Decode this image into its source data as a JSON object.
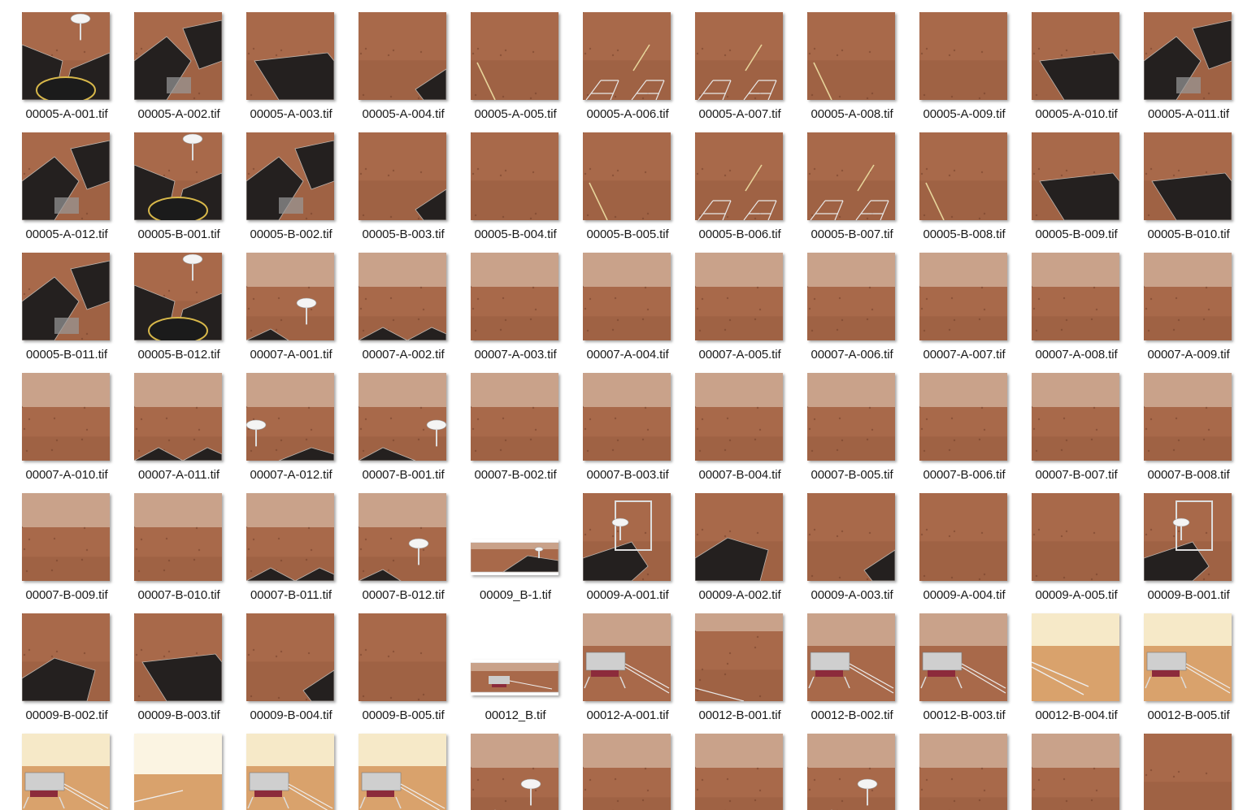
{
  "files": [
    {
      "name": "00005-A-001.tif",
      "kind": "rover_dish"
    },
    {
      "name": "00005-A-002.tif",
      "kind": "rover_panel"
    },
    {
      "name": "00005-A-003.tif",
      "kind": "panel_ground"
    },
    {
      "name": "00005-A-004.tif",
      "kind": "ground_panel_corner"
    },
    {
      "name": "00005-A-005.tif",
      "kind": "ground_rod"
    },
    {
      "name": "00005-A-006.tif",
      "kind": "ground_ramp"
    },
    {
      "name": "00005-A-007.tif",
      "kind": "ground_ramp"
    },
    {
      "name": "00005-A-008.tif",
      "kind": "ground_rod"
    },
    {
      "name": "00005-A-009.tif",
      "kind": "ground"
    },
    {
      "name": "00005-A-010.tif",
      "kind": "panel_ground"
    },
    {
      "name": "00005-A-011.tif",
      "kind": "rover_panel"
    },
    {
      "name": "00005-A-012.tif",
      "kind": "rover_panel"
    },
    {
      "name": "00005-B-001.tif",
      "kind": "rover_dish"
    },
    {
      "name": "00005-B-002.tif",
      "kind": "rover_panel"
    },
    {
      "name": "00005-B-003.tif",
      "kind": "ground_panel_corner"
    },
    {
      "name": "00005-B-004.tif",
      "kind": "ground"
    },
    {
      "name": "00005-B-005.tif",
      "kind": "ground_rod"
    },
    {
      "name": "00005-B-006.tif",
      "kind": "ground_ramp"
    },
    {
      "name": "00005-B-007.tif",
      "kind": "ground_ramp"
    },
    {
      "name": "00005-B-008.tif",
      "kind": "ground_rod"
    },
    {
      "name": "00005-B-009.tif",
      "kind": "panel_ground"
    },
    {
      "name": "00005-B-010.tif",
      "kind": "panel_ground"
    },
    {
      "name": "00005-B-011.tif",
      "kind": "rover_panel"
    },
    {
      "name": "00005-B-012.tif",
      "kind": "rover_dish"
    },
    {
      "name": "00007-A-001.tif",
      "kind": "horizon_dish"
    },
    {
      "name": "00007-A-002.tif",
      "kind": "horizon_panel"
    },
    {
      "name": "00007-A-003.tif",
      "kind": "horizon"
    },
    {
      "name": "00007-A-004.tif",
      "kind": "horizon"
    },
    {
      "name": "00007-A-005.tif",
      "kind": "horizon"
    },
    {
      "name": "00007-A-006.tif",
      "kind": "horizon"
    },
    {
      "name": "00007-A-007.tif",
      "kind": "horizon"
    },
    {
      "name": "00007-A-008.tif",
      "kind": "horizon"
    },
    {
      "name": "00007-A-009.tif",
      "kind": "horizon"
    },
    {
      "name": "00007-A-010.tif",
      "kind": "horizon"
    },
    {
      "name": "00007-A-011.tif",
      "kind": "horizon_panel"
    },
    {
      "name": "00007-A-012.tif",
      "kind": "horizon_dish_left"
    },
    {
      "name": "00007-B-001.tif",
      "kind": "horizon_dish_right"
    },
    {
      "name": "00007-B-002.tif",
      "kind": "horizon"
    },
    {
      "name": "00007-B-003.tif",
      "kind": "horizon"
    },
    {
      "name": "00007-B-004.tif",
      "kind": "horizon"
    },
    {
      "name": "00007-B-005.tif",
      "kind": "horizon"
    },
    {
      "name": "00007-B-006.tif",
      "kind": "horizon"
    },
    {
      "name": "00007-B-007.tif",
      "kind": "horizon"
    },
    {
      "name": "00007-B-008.tif",
      "kind": "horizon"
    },
    {
      "name": "00007-B-009.tif",
      "kind": "horizon"
    },
    {
      "name": "00007-B-010.tif",
      "kind": "horizon"
    },
    {
      "name": "00007-B-011.tif",
      "kind": "horizon_panel"
    },
    {
      "name": "00007-B-012.tif",
      "kind": "horizon_dish"
    },
    {
      "name": "00009_B-1.tif",
      "kind": "pano_rover"
    },
    {
      "name": "00009-A-001.tif",
      "kind": "rover_mast"
    },
    {
      "name": "00009-A-002.tif",
      "kind": "rover_panel_ground"
    },
    {
      "name": "00009-A-003.tif",
      "kind": "ground_panel_corner"
    },
    {
      "name": "00009-A-004.tif",
      "kind": "ground"
    },
    {
      "name": "00009-A-005.tif",
      "kind": "ground"
    },
    {
      "name": "00009-B-001.tif",
      "kind": "rover_mast"
    },
    {
      "name": "00009-B-002.tif",
      "kind": "rover_panel_ground"
    },
    {
      "name": "00009-B-003.tif",
      "kind": "panel_ground"
    },
    {
      "name": "00009-B-004.tif",
      "kind": "ground_panel_corner"
    },
    {
      "name": "00009-B-005.tif",
      "kind": "ground"
    },
    {
      "name": "00012_B.tif",
      "kind": "pano_lander"
    },
    {
      "name": "00012-A-001.tif",
      "kind": "lander"
    },
    {
      "name": "00012-B-001.tif",
      "kind": "ground_ramp_far"
    },
    {
      "name": "00012-B-002.tif",
      "kind": "lander"
    },
    {
      "name": "00012-B-003.tif",
      "kind": "lander"
    },
    {
      "name": "00012-B-004.tif",
      "kind": "lander_bright_ramp"
    },
    {
      "name": "00012-B-005.tif",
      "kind": "lander_bright"
    },
    {
      "name": "",
      "kind": "lander_bright"
    },
    {
      "name": "",
      "kind": "bright_ramp"
    },
    {
      "name": "",
      "kind": "lander_bright"
    },
    {
      "name": "",
      "kind": "lander_bright"
    },
    {
      "name": "",
      "kind": "horizon_dish"
    },
    {
      "name": "",
      "kind": "horizon"
    },
    {
      "name": "",
      "kind": "horizon"
    },
    {
      "name": "",
      "kind": "horizon_dish"
    },
    {
      "name": "",
      "kind": "horizon"
    },
    {
      "name": "",
      "kind": "horizon"
    },
    {
      "name": "",
      "kind": "ground"
    }
  ],
  "colors": {
    "mars_ground": "#a8694a",
    "mars_ground_dark": "#8e5538",
    "mars_sky": "#c9a28a",
    "panel": "#24201f",
    "bright_sky": "#f6e9c8",
    "bright_ground": "#d9a26c"
  }
}
